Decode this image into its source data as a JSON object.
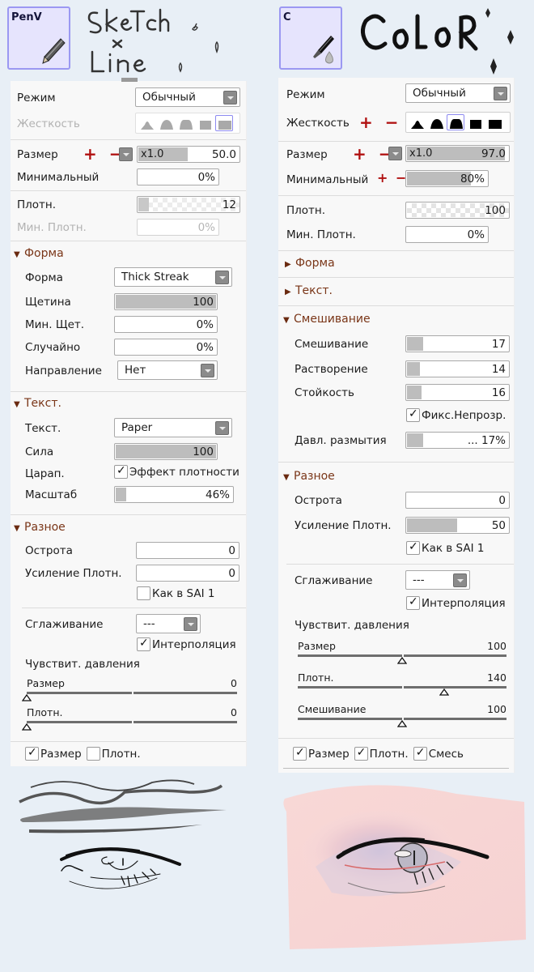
{
  "left_brush": {
    "tile_name": "PenV",
    "tile_icon": "pencil-icon",
    "title_lines": [
      "SkeTch",
      "×",
      "Line"
    ],
    "mode": {
      "label": "Режим",
      "value": "Обычный"
    },
    "hardness": {
      "label": "Жесткость",
      "disabled": true,
      "selected_index": 4,
      "options": [
        "peak-1",
        "peak-2",
        "peak-3",
        "flat-1",
        "flat-2"
      ]
    },
    "size": {
      "label": "Размер",
      "annotation": "+ −",
      "multiplier": "x1.0",
      "value": "50.0",
      "fill": 0.5
    },
    "min_size": {
      "label": "Минимальный",
      "value": "0%",
      "fill": 0
    },
    "density": {
      "label": "Плотн.",
      "value": "12",
      "fill": 0.12
    },
    "min_density": {
      "label": "Мин. Плотн.",
      "value": "0%",
      "disabled": true
    },
    "shape_section": {
      "title": "Форма",
      "expanded": true,
      "shape": {
        "label": "Форма",
        "value": "Thick Streak"
      },
      "bristle": {
        "label": "Щетина",
        "value": "100",
        "fill": 1.0
      },
      "min_bristle": {
        "label": "Мин. Щет.",
        "value": "0%"
      },
      "random": {
        "label": "Случайно",
        "value": "0%"
      },
      "direction": {
        "label": "Направление",
        "value": "Нет"
      }
    },
    "texture_section": {
      "title": "Текст.",
      "expanded": true,
      "texture": {
        "label": "Текст.",
        "value": "Paper"
      },
      "strength": {
        "label": "Сила",
        "value": "100",
        "fill": 1.0
      },
      "scratch": {
        "label": "Царап.",
        "checkbox_label": "Эффект плотности",
        "checked": true
      },
      "scale": {
        "label": "Масштаб",
        "value": "46%",
        "fill": 0.1
      }
    },
    "misc_section": {
      "title": "Разное",
      "expanded": true,
      "sharpness": {
        "label": "Острота",
        "value": "0"
      },
      "density_boost": {
        "label": "Усиление Плотн.",
        "value": "0"
      },
      "sai1": {
        "label": "Как в SAI 1",
        "checked": false
      },
      "smoothing": {
        "label": "Сглаживание",
        "value": "---"
      },
      "interpolation": {
        "label": "Интерполяция",
        "checked": true
      }
    },
    "pressure": {
      "title": "Чувствит. давления",
      "sliders": [
        {
          "label": "Размер",
          "value": "0",
          "position": 0.0
        },
        {
          "label": "Плотн.",
          "value": "0",
          "position": 0.0
        }
      ]
    },
    "footer_checks": [
      {
        "label": "Размер",
        "checked": true
      },
      {
        "label": "Плотн.",
        "checked": false
      }
    ]
  },
  "right_brush": {
    "tile_name": "C",
    "tile_icon": "brush-water-drop-icon",
    "title": "CoLoR",
    "mode": {
      "label": "Режим",
      "value": "Обычный"
    },
    "hardness": {
      "label": "Жесткость",
      "annotation": "+ −",
      "disabled": false,
      "selected_index": 2,
      "options": [
        "peak-1",
        "peak-2",
        "peak-3",
        "flat-1",
        "flat-2"
      ]
    },
    "size": {
      "label": "Размер",
      "annotation": "+ −",
      "multiplier": "x1.0",
      "value": "97.0",
      "fill": 0.97
    },
    "min_size": {
      "label": "Минимальный",
      "annotation": "+ −",
      "value": "80%",
      "fill": 0.8
    },
    "density": {
      "label": "Плотн.",
      "value": "100",
      "fill": 1.0
    },
    "min_density": {
      "label": "Мин. Плотн.",
      "value": "0%"
    },
    "shape_section": {
      "title": "Форма",
      "expanded": false
    },
    "texture_section": {
      "title": "Текст.",
      "expanded": false
    },
    "blend_section": {
      "title": "Смешивание",
      "expanded": true,
      "blending": {
        "label": "Смешивание",
        "value": "17",
        "fill": 0.17
      },
      "dilution": {
        "label": "Растворение",
        "value": "14",
        "fill": 0.14
      },
      "persistence": {
        "label": "Стойкость",
        "value": "16",
        "fill": 0.16
      },
      "keep_opacity": {
        "label": "Фикс.Непрозр.",
        "checked": true
      },
      "blur_pressure": {
        "label": "Давл. размытия",
        "value": "... 17%",
        "fill": 0.17
      }
    },
    "misc_section": {
      "title": "Разное",
      "expanded": true,
      "sharpness": {
        "label": "Острота",
        "value": "0"
      },
      "density_boost": {
        "label": "Усиление Плотн.",
        "value": "50",
        "fill": 0.5
      },
      "sai1": {
        "label": "Как в SAI 1",
        "checked": true
      },
      "smoothing": {
        "label": "Сглаживание",
        "value": "---"
      },
      "interpolation": {
        "label": "Интерполяция",
        "checked": true
      }
    },
    "pressure": {
      "title": "Чувствит. давления",
      "sliders": [
        {
          "label": "Размер",
          "value": "100",
          "position": 0.5
        },
        {
          "label": "Плотн.",
          "value": "140",
          "position": 0.7
        },
        {
          "label": "Смешивание",
          "value": "100",
          "position": 0.5
        }
      ]
    },
    "footer_checks": [
      {
        "label": "Размер",
        "checked": true
      },
      {
        "label": "Плотн.",
        "checked": true
      },
      {
        "label": "Смесь",
        "checked": true
      }
    ]
  },
  "colors": {
    "background": "#e8eff6",
    "panel": "#f8f8f8",
    "tile_bg": "#e6e4fd",
    "tile_border": "#9b98f2",
    "section_title": "#7a3618",
    "annotation_red": "#b01010",
    "skin": "#f7d8d8"
  }
}
